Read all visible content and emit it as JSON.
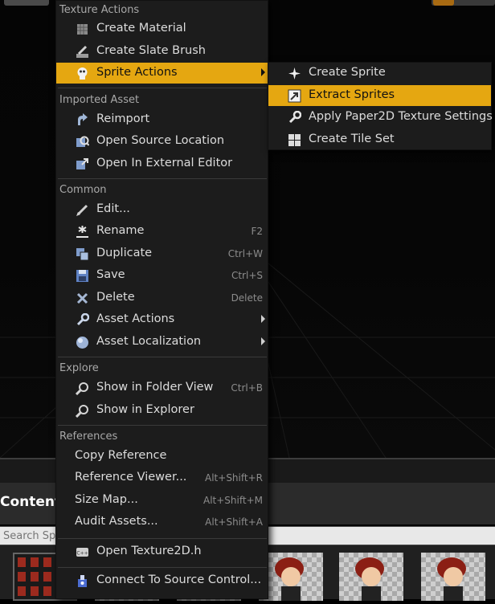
{
  "context_menu": {
    "sections": {
      "texture_actions": "Texture Actions",
      "imported_asset": "Imported Asset",
      "common": "Common",
      "explore": "Explore",
      "references": "References"
    },
    "items": {
      "create_material": "Create Material",
      "create_slate_brush": "Create Slate Brush",
      "sprite_actions": "Sprite Actions",
      "reimport": "Reimport",
      "open_source_location": "Open Source Location",
      "open_in_external_editor": "Open In External Editor",
      "edit": "Edit...",
      "rename": {
        "label": "Rename",
        "shortcut": "F2"
      },
      "duplicate": {
        "label": "Duplicate",
        "shortcut": "Ctrl+W"
      },
      "save": {
        "label": "Save",
        "shortcut": "Ctrl+S"
      },
      "delete": {
        "label": "Delete",
        "shortcut": "Delete"
      },
      "asset_actions": "Asset Actions",
      "asset_localization": "Asset Localization",
      "show_in_folder_view": {
        "label": "Show in Folder View",
        "shortcut": "Ctrl+B"
      },
      "show_in_explorer": "Show in Explorer",
      "copy_reference": "Copy Reference",
      "reference_viewer": {
        "label": "Reference Viewer...",
        "shortcut": "Alt+Shift+R"
      },
      "size_map": {
        "label": "Size Map...",
        "shortcut": "Alt+Shift+M"
      },
      "audit_assets": {
        "label": "Audit Assets...",
        "shortcut": "Alt+Shift+A"
      },
      "open_texture2d_h": "Open Texture2D.h",
      "connect_to_source_control": "Connect To Source Control..."
    },
    "highlighted": "sprite_actions"
  },
  "submenu": {
    "items": {
      "create_sprite": "Create Sprite",
      "extract_sprites": "Extract Sprites",
      "apply_paper2d_settings": "Apply Paper2D Texture Settings",
      "create_tile_set": "Create Tile Set"
    },
    "highlighted": "extract_sprites"
  },
  "content_browser": {
    "title": "Content",
    "search_placeholder": "Search Sp"
  },
  "colors": {
    "highlight": "#e5a711",
    "menu_background": "#1c1c1c",
    "section_header": "#a9a9a9"
  }
}
